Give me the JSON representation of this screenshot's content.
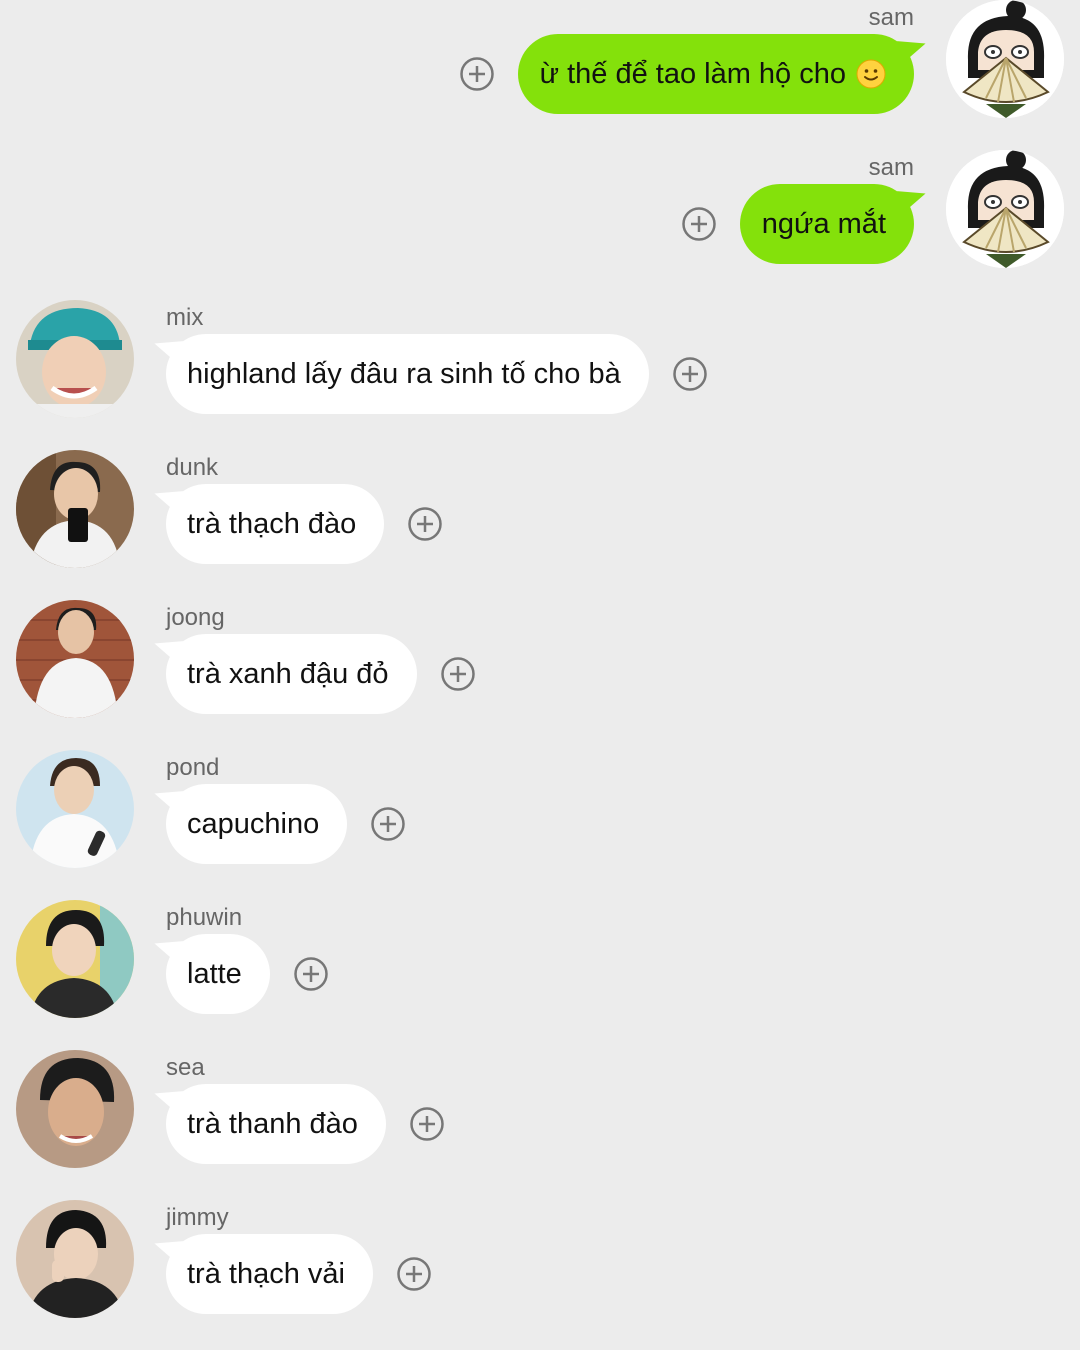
{
  "messages": [
    {
      "direction": "out",
      "sender": "sam",
      "text": "ừ thế để tao làm hộ cho",
      "emoji": "slightly-smiling-face"
    },
    {
      "direction": "out",
      "sender": "sam",
      "text": "ngứa mắt"
    },
    {
      "direction": "in",
      "sender": "mix",
      "text": "highland lấy đâu ra sinh tố cho bà"
    },
    {
      "direction": "in",
      "sender": "dunk",
      "text": "trà thạch đào"
    },
    {
      "direction": "in",
      "sender": "joong",
      "text": "trà xanh đậu đỏ"
    },
    {
      "direction": "in",
      "sender": "pond",
      "text": "capuchino"
    },
    {
      "direction": "in",
      "sender": "phuwin",
      "text": "latte"
    },
    {
      "direction": "in",
      "sender": "sea",
      "text": "trà thanh đào"
    },
    {
      "direction": "in",
      "sender": "jimmy",
      "text": "trà thạch vải"
    }
  ],
  "colors": {
    "background": "#ececec",
    "outgoing_bubble": "#84e10b",
    "incoming_bubble": "#ffffff",
    "reaction_icon": "#777777"
  },
  "icons": {
    "reaction": "add-reaction-icon",
    "emoji": "slightly-smiling-face-icon"
  }
}
